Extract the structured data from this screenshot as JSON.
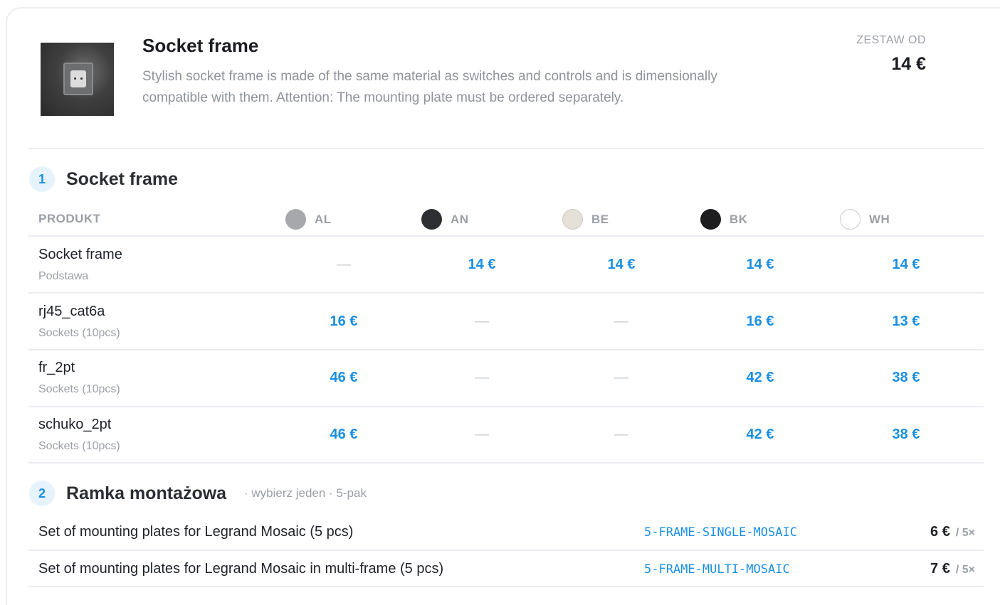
{
  "product": {
    "title": "Socket frame",
    "description": "Stylish socket frame is made of the same material as switches and controls and is dimensionally compatible with them. Attention: The mounting plate must be ordered separately.",
    "price_label": "ZESTAW OD",
    "price_value": "14 €"
  },
  "section1": {
    "number": "1",
    "title": "Socket frame",
    "product_header": "PRODUKT",
    "colors": [
      {
        "code": "AL",
        "color": "#a7a8ab"
      },
      {
        "code": "AN",
        "color": "#2d2f33"
      },
      {
        "code": "BE",
        "color": "#e6e1d8"
      },
      {
        "code": "BK",
        "color": "#1d1d1f"
      },
      {
        "code": "WH",
        "color": "#ffffff"
      }
    ],
    "rows": [
      {
        "name": "Socket frame",
        "sub": "Podstawa",
        "prices": [
          "—",
          "14 €",
          "14 €",
          "14 €",
          "14 €"
        ]
      },
      {
        "name": "rj45_cat6a",
        "sub": "Sockets (10pcs)",
        "prices": [
          "16 €",
          "—",
          "—",
          "16 €",
          "13 €"
        ]
      },
      {
        "name": "fr_2pt",
        "sub": "Sockets (10pcs)",
        "prices": [
          "46 €",
          "—",
          "—",
          "42 €",
          "38 €"
        ]
      },
      {
        "name": "schuko_2pt",
        "sub": "Sockets (10pcs)",
        "prices": [
          "46 €",
          "—",
          "—",
          "42 €",
          "38 €"
        ]
      }
    ]
  },
  "section2": {
    "number": "2",
    "title": "Ramka montażowa",
    "note": "· wybierz jeden · 5-pak",
    "plates": [
      {
        "name": "Set of mounting plates for Legrand Mosaic (5 pcs)",
        "code": "5-FRAME-SINGLE-MOSAIC",
        "price": "6 €",
        "pack": "/ 5×"
      },
      {
        "name": "Set of mounting plates for Legrand Mosaic in multi-frame (5 pcs)",
        "code": "5-FRAME-MULTI-MOSAIC",
        "price": "7 €",
        "pack": "/ 5×"
      }
    ]
  },
  "accent_color": "#1a8fe3"
}
